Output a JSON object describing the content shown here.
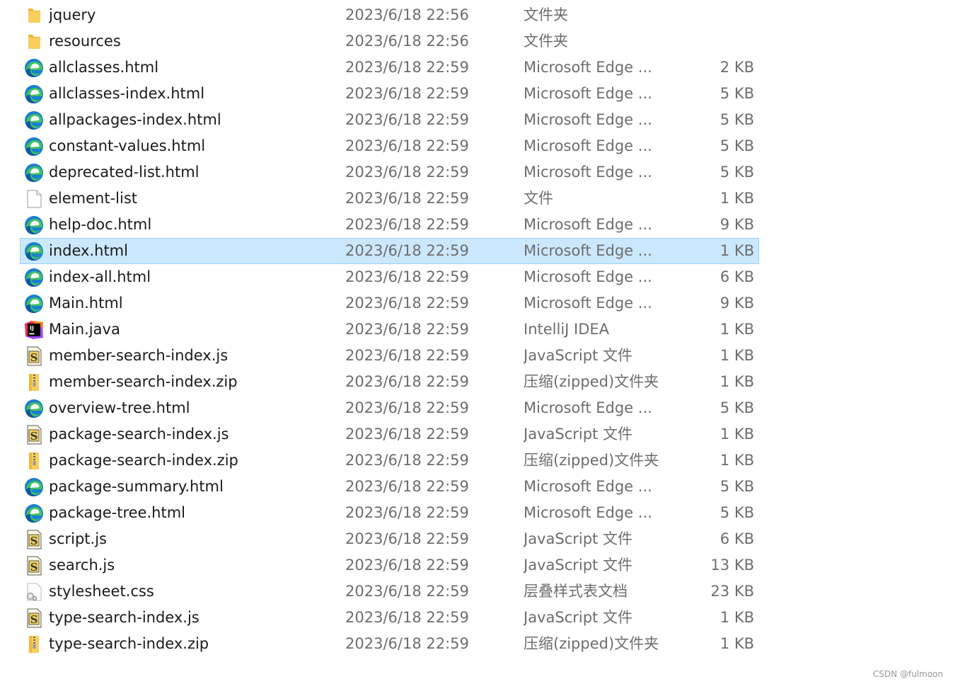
{
  "files": [
    {
      "name": "jquery",
      "date": "2023/6/18 22:56",
      "type": "文件夹",
      "size": "",
      "icon": "folder-icon"
    },
    {
      "name": "resources",
      "date": "2023/6/18 22:56",
      "type": "文件夹",
      "size": "",
      "icon": "folder-icon"
    },
    {
      "name": "allclasses.html",
      "date": "2023/6/18 22:59",
      "type": "Microsoft Edge ...",
      "size": "2 KB",
      "icon": "edge-icon"
    },
    {
      "name": "allclasses-index.html",
      "date": "2023/6/18 22:59",
      "type": "Microsoft Edge ...",
      "size": "5 KB",
      "icon": "edge-icon"
    },
    {
      "name": "allpackages-index.html",
      "date": "2023/6/18 22:59",
      "type": "Microsoft Edge ...",
      "size": "5 KB",
      "icon": "edge-icon"
    },
    {
      "name": "constant-values.html",
      "date": "2023/6/18 22:59",
      "type": "Microsoft Edge ...",
      "size": "5 KB",
      "icon": "edge-icon"
    },
    {
      "name": "deprecated-list.html",
      "date": "2023/6/18 22:59",
      "type": "Microsoft Edge ...",
      "size": "5 KB",
      "icon": "edge-icon"
    },
    {
      "name": "element-list",
      "date": "2023/6/18 22:59",
      "type": "文件",
      "size": "1 KB",
      "icon": "blank-file-icon"
    },
    {
      "name": "help-doc.html",
      "date": "2023/6/18 22:59",
      "type": "Microsoft Edge ...",
      "size": "9 KB",
      "icon": "edge-icon"
    },
    {
      "name": "index.html",
      "date": "2023/6/18 22:59",
      "type": "Microsoft Edge ...",
      "size": "1 KB",
      "icon": "edge-icon",
      "selected": true
    },
    {
      "name": "index-all.html",
      "date": "2023/6/18 22:59",
      "type": "Microsoft Edge ...",
      "size": "6 KB",
      "icon": "edge-icon"
    },
    {
      "name": "Main.html",
      "date": "2023/6/18 22:59",
      "type": "Microsoft Edge ...",
      "size": "9 KB",
      "icon": "edge-icon"
    },
    {
      "name": "Main.java",
      "date": "2023/6/18 22:59",
      "type": "IntelliJ IDEA",
      "size": "1 KB",
      "icon": "intellij-icon"
    },
    {
      "name": "member-search-index.js",
      "date": "2023/6/18 22:59",
      "type": "JavaScript 文件",
      "size": "1 KB",
      "icon": "script-file-icon"
    },
    {
      "name": "member-search-index.zip",
      "date": "2023/6/18 22:59",
      "type": "压缩(zipped)文件夹",
      "size": "1 KB",
      "icon": "zip-folder-icon"
    },
    {
      "name": "overview-tree.html",
      "date": "2023/6/18 22:59",
      "type": "Microsoft Edge ...",
      "size": "5 KB",
      "icon": "edge-icon"
    },
    {
      "name": "package-search-index.js",
      "date": "2023/6/18 22:59",
      "type": "JavaScript 文件",
      "size": "1 KB",
      "icon": "script-file-icon"
    },
    {
      "name": "package-search-index.zip",
      "date": "2023/6/18 22:59",
      "type": "压缩(zipped)文件夹",
      "size": "1 KB",
      "icon": "zip-folder-icon"
    },
    {
      "name": "package-summary.html",
      "date": "2023/6/18 22:59",
      "type": "Microsoft Edge ...",
      "size": "5 KB",
      "icon": "edge-icon"
    },
    {
      "name": "package-tree.html",
      "date": "2023/6/18 22:59",
      "type": "Microsoft Edge ...",
      "size": "5 KB",
      "icon": "edge-icon"
    },
    {
      "name": "script.js",
      "date": "2023/6/18 22:59",
      "type": "JavaScript 文件",
      "size": "6 KB",
      "icon": "script-file-icon"
    },
    {
      "name": "search.js",
      "date": "2023/6/18 22:59",
      "type": "JavaScript 文件",
      "size": "13 KB",
      "icon": "script-file-icon"
    },
    {
      "name": "stylesheet.css",
      "date": "2023/6/18 22:59",
      "type": "层叠样式表文档",
      "size": "23 KB",
      "icon": "css-file-icon"
    },
    {
      "name": "type-search-index.js",
      "date": "2023/6/18 22:59",
      "type": "JavaScript 文件",
      "size": "1 KB",
      "icon": "script-file-icon"
    },
    {
      "name": "type-search-index.zip",
      "date": "2023/6/18 22:59",
      "type": "压缩(zipped)文件夹",
      "size": "1 KB",
      "icon": "zip-folder-icon"
    }
  ],
  "watermark": "CSDN @fulmoon",
  "colors": {
    "selection_bg": "#cce8ff",
    "selection_border": "#99d1ff",
    "name_text": "#1a1a1a",
    "secondary_text": "#6d6d6d",
    "folder": "#f8c44f",
    "edge_blue": "#0c59a4",
    "edge_green": "#47c05c"
  }
}
